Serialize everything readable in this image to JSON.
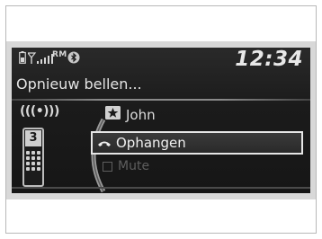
{
  "status": {
    "roaming_label": "RM",
    "clock": "12:34",
    "icons": [
      "battery-icon",
      "signal-strength-icon",
      "bluetooth-icon"
    ]
  },
  "screen": {
    "title": "Opnieuw bellen...",
    "signal_indicator": "(((•)))",
    "contact": {
      "icon": "star-icon",
      "name": "John"
    },
    "phone_badge": "3",
    "options": [
      {
        "label": "Ophangen",
        "icon": "hang-up-icon",
        "selected": true
      },
      {
        "label": "Mute",
        "icon": "checkbox-icon",
        "selected": false,
        "enabled": false
      }
    ]
  },
  "colors": {
    "screen_bg": "#1b1b1b",
    "text": "#e4e4e4",
    "disabled_text": "#5e5e5e",
    "band": "#d8d8d8",
    "highlight_border": "#e6e6e6"
  }
}
